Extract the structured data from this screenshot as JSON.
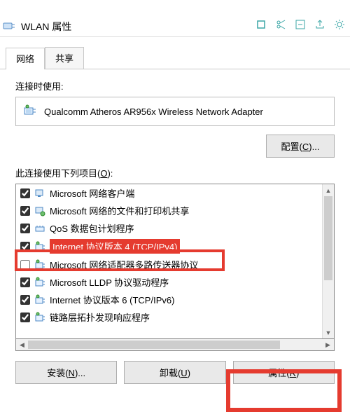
{
  "toolbar_icons": [
    "square-icon",
    "scissors-icon",
    "arrow-icon",
    "share-icon",
    "gear-icon"
  ],
  "window": {
    "title": "WLAN 属性"
  },
  "tabs": {
    "network": "网络",
    "sharing": "共享"
  },
  "labels": {
    "connect_using": "连接时使用:",
    "items_using": "此连接使用下列项目(",
    "items_using_u": "O",
    "items_using_end": "):"
  },
  "adapter": {
    "name": "Qualcomm Atheros AR956x Wireless Network Adapter"
  },
  "buttons": {
    "configure": "配置(",
    "configure_u": "C",
    "configure_end": ")...",
    "install": "安装(",
    "install_u": "N",
    "install_end": ")...",
    "uninstall": "卸载(",
    "uninstall_u": "U",
    "uninstall_end": ")",
    "properties": "属性(",
    "properties_u": "R",
    "properties_end": ")"
  },
  "items": [
    {
      "checked": true,
      "icon": "client",
      "label": "Microsoft 网络客户端"
    },
    {
      "checked": true,
      "icon": "share",
      "label": "Microsoft 网络的文件和打印机共享"
    },
    {
      "checked": true,
      "icon": "qos",
      "label": "QoS 数据包计划程序"
    },
    {
      "checked": true,
      "icon": "proto",
      "label": "Internet 协议版本 4 (TCP/IPv4)",
      "selected": true
    },
    {
      "checked": false,
      "icon": "proto",
      "label": "Microsoft 网络适配器多路传送器协议"
    },
    {
      "checked": true,
      "icon": "proto",
      "label": "Microsoft LLDP 协议驱动程序"
    },
    {
      "checked": true,
      "icon": "proto",
      "label": "Internet 协议版本 6 (TCP/IPv6)"
    },
    {
      "checked": true,
      "icon": "proto",
      "label": "链路层拓扑发现响应程序"
    }
  ]
}
